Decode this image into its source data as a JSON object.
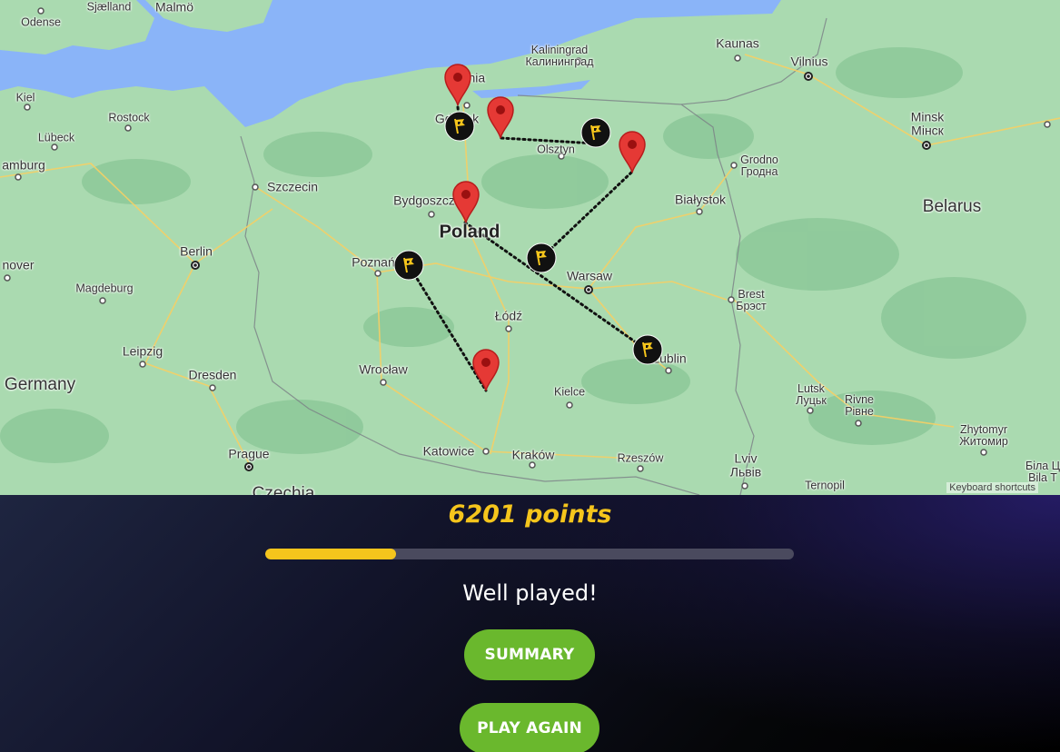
{
  "map": {
    "labels": [
      {
        "id": "odense",
        "text": "Odense",
        "cls": "small"
      },
      {
        "id": "sjaelland",
        "text": "Sjælland",
        "cls": "small"
      },
      {
        "id": "malmo",
        "text": "Malmö",
        "cls": ""
      },
      {
        "id": "kiel",
        "text": "Kiel",
        "cls": "small"
      },
      {
        "id": "rostock",
        "text": "Rostock",
        "cls": "small"
      },
      {
        "id": "lubeck",
        "text": "Lübeck",
        "cls": "small"
      },
      {
        "id": "hamburg",
        "text": "amburg",
        "cls": ""
      },
      {
        "id": "hanover",
        "text": "nover",
        "cls": ""
      },
      {
        "id": "szczecin",
        "text": "Szczecin",
        "cls": ""
      },
      {
        "id": "berlin",
        "text": "Berlin",
        "cls": ""
      },
      {
        "id": "magdeburg",
        "text": "Magdeburg",
        "cls": "small"
      },
      {
        "id": "leipzig",
        "text": "Leipzig",
        "cls": ""
      },
      {
        "id": "dresden",
        "text": "Dresden",
        "cls": ""
      },
      {
        "id": "germany",
        "text": "Germany",
        "cls": "country-sm"
      },
      {
        "id": "prague",
        "text": "Prague",
        "cls": ""
      },
      {
        "id": "czechia",
        "text": "Czechia",
        "cls": "country-sm"
      },
      {
        "id": "gdansk",
        "text": "Gdańsk",
        "cls": ""
      },
      {
        "id": "gdynia",
        "text": "Gdynia",
        "cls": ""
      },
      {
        "id": "kaliningrad",
        "text": "Kaliningrad\nКалининград",
        "cls": "small"
      },
      {
        "id": "kaunas",
        "text": "Kaunas",
        "cls": ""
      },
      {
        "id": "vilnius",
        "text": "Vilnius",
        "cls": ""
      },
      {
        "id": "minsk",
        "text": "Minsk\nМінск",
        "cls": ""
      },
      {
        "id": "olsztyn",
        "text": "Olsztyn",
        "cls": "small"
      },
      {
        "id": "grodno",
        "text": "Grodno\nГродна",
        "cls": "small"
      },
      {
        "id": "bialystok",
        "text": "Białystok",
        "cls": ""
      },
      {
        "id": "belarus",
        "text": "Belarus",
        "cls": "country-sm"
      },
      {
        "id": "bydgoszcz",
        "text": "Bydgoszcz",
        "cls": ""
      },
      {
        "id": "poland",
        "text": "Poland",
        "cls": "country"
      },
      {
        "id": "poznan",
        "text": "Poznań",
        "cls": ""
      },
      {
        "id": "warsaw",
        "text": "Warsaw",
        "cls": ""
      },
      {
        "id": "lodz",
        "text": "Łódź",
        "cls": ""
      },
      {
        "id": "brest",
        "text": "Brest\nБрэст",
        "cls": "small"
      },
      {
        "id": "wroclaw",
        "text": "Wrocław",
        "cls": ""
      },
      {
        "id": "lublin",
        "text": "Lublin",
        "cls": ""
      },
      {
        "id": "kielce",
        "text": "Kielce",
        "cls": "small"
      },
      {
        "id": "lutsk",
        "text": "Lutsk\nЛуцьк",
        "cls": "small"
      },
      {
        "id": "rivne",
        "text": "Rivne\nРівне",
        "cls": "small"
      },
      {
        "id": "zhytomyr",
        "text": "Zhytomyr\nЖитомир",
        "cls": "small"
      },
      {
        "id": "katowice",
        "text": "Katowice",
        "cls": ""
      },
      {
        "id": "krakow",
        "text": "Kraków",
        "cls": ""
      },
      {
        "id": "rzeszow",
        "text": "Rzeszów",
        "cls": "small"
      },
      {
        "id": "lviv",
        "text": "Lviv\nЛьвів",
        "cls": ""
      },
      {
        "id": "ternopil",
        "text": "Ternopil",
        "cls": "small"
      },
      {
        "id": "bila",
        "text": "Біла Ц\nBila T",
        "cls": "small"
      }
    ],
    "keyboard_shortcuts": "Keyboard shortcuts",
    "pin_icon": "map-pin-red",
    "flag_icon": "flag-marker",
    "pin_color": "#e53935",
    "flag_color": "#f5c51c"
  },
  "result": {
    "score_text": "6201 points",
    "progress": 0.248,
    "message": "Well played!",
    "summary_label": "SUMMARY",
    "play_again_label": "PLAY AGAIN"
  },
  "colors": {
    "accent": "#f5c51c",
    "button": "#6ab82d",
    "land": "#aadab0",
    "water": "#8ab4f8"
  }
}
